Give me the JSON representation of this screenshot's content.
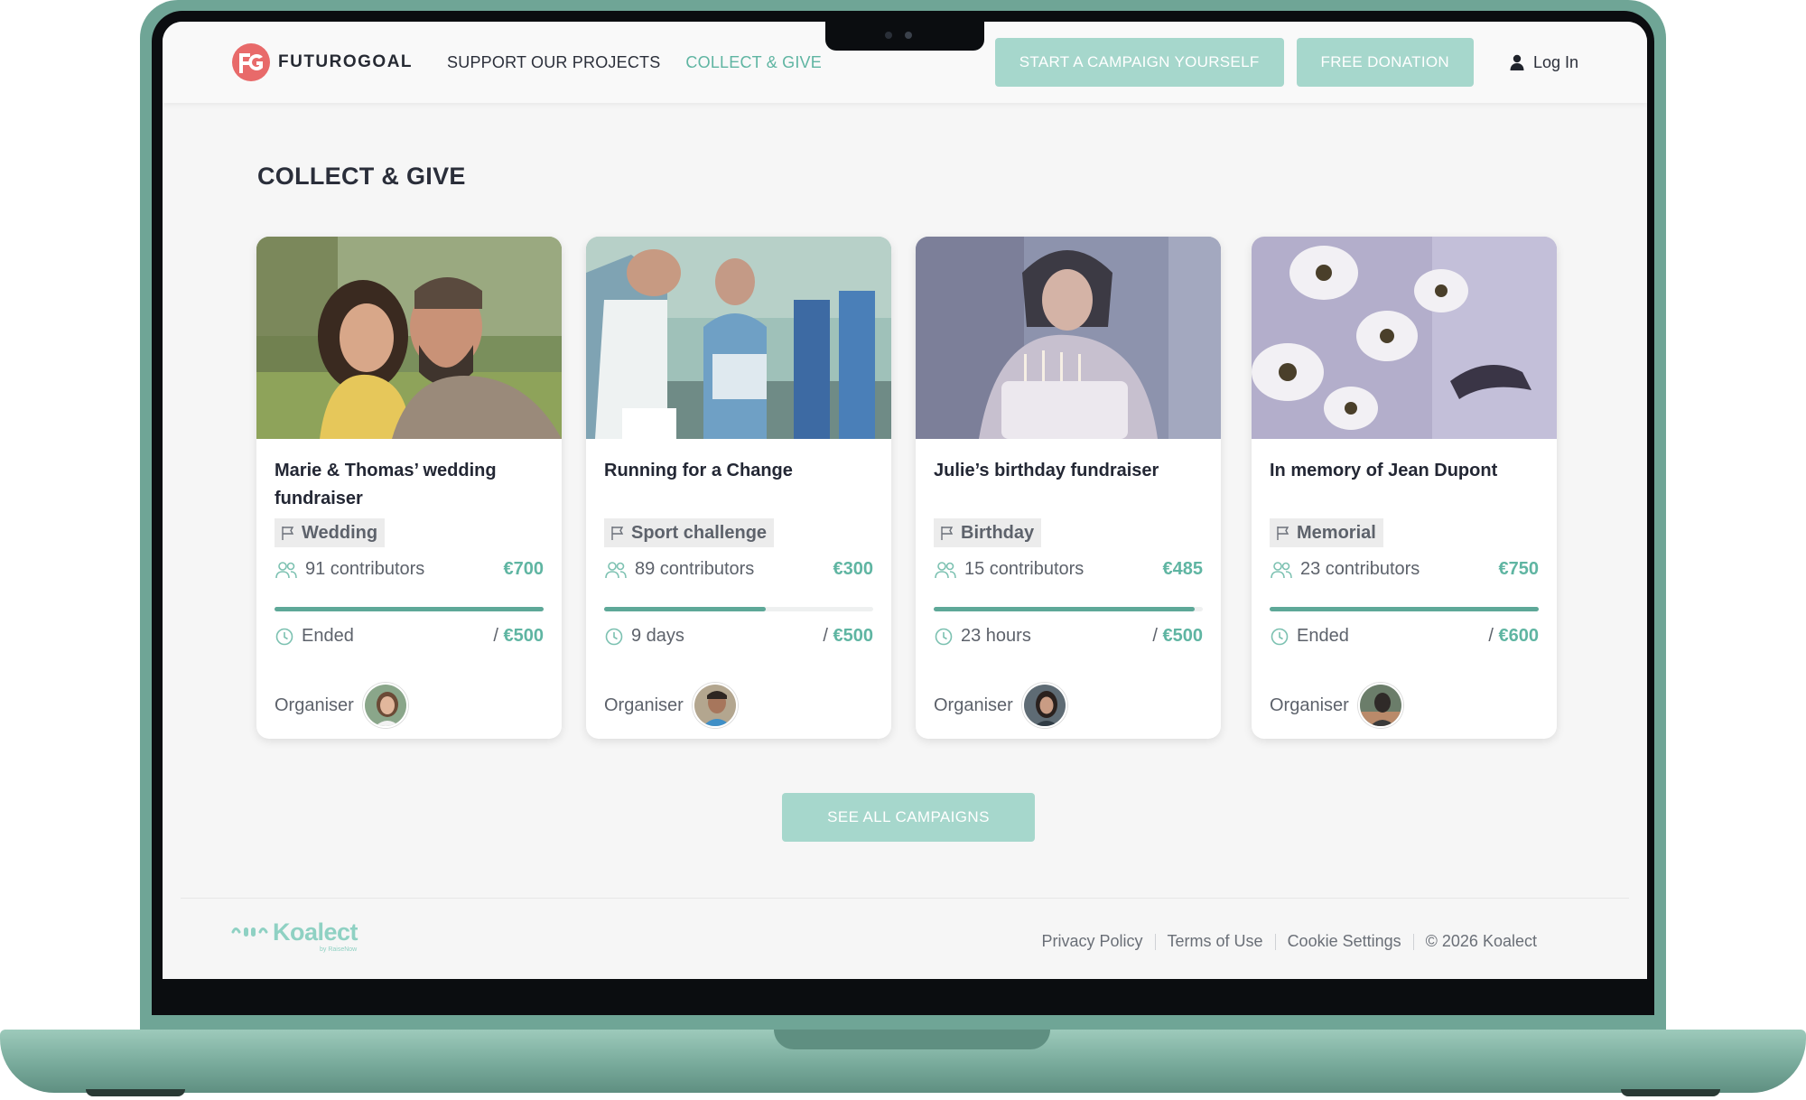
{
  "brand": {
    "name": "FUTUROGOAL",
    "logo_monogram": "FG",
    "accent_color": "#5fb5a2",
    "button_color": "#a6d7cc",
    "logo_color": "#e86a6a"
  },
  "nav": {
    "items": [
      {
        "label": "SUPPORT OUR PROJECTS",
        "active": false
      },
      {
        "label": "COLLECT & GIVE",
        "active": true
      }
    ]
  },
  "header": {
    "start_campaign": "START A CAMPAIGN YOURSELF",
    "free_donation": "FREE DONATION",
    "login": "Log In",
    "login_icon": "user-icon"
  },
  "main": {
    "title": "COLLECT & GIVE",
    "see_all": "SEE ALL CAMPAIGNS"
  },
  "campaigns": [
    {
      "title": "Marie & Thomas’ wedding fundraiser",
      "category": "Wedding",
      "contributors": "91 contributors",
      "raised": "€700",
      "time_left": "Ended",
      "goal": "€500",
      "progress": 1.0,
      "organiser_label": "Organiser",
      "image": "couple-photo"
    },
    {
      "title": "Running for a Change",
      "category": "Sport challenge",
      "contributors": "89 contributors",
      "raised": "€300",
      "time_left": "9 days",
      "goal": "€500",
      "progress": 0.6,
      "organiser_label": "Organiser",
      "image": "runners-photo"
    },
    {
      "title": "Julie’s birthday fundraiser",
      "category": "Birthday",
      "contributors": "15 contributors",
      "raised": "€485",
      "time_left": "23 hours",
      "goal": "€500",
      "progress": 0.97,
      "organiser_label": "Organiser",
      "image": "birthday-cake-photo"
    },
    {
      "title": "In memory of Jean Dupont",
      "category": "Memorial",
      "contributors": "23 contributors",
      "raised": "€750",
      "time_left": "Ended",
      "goal": "€600",
      "progress": 1.0,
      "organiser_label": "Organiser",
      "image": "daisies-photo"
    }
  ],
  "footer": {
    "logo": "Koalect",
    "logo_byline": "by RaiseNow",
    "links": [
      "Privacy Policy",
      "Terms of Use",
      "Cookie Settings"
    ],
    "copyright": "© 2026 Koalect"
  }
}
